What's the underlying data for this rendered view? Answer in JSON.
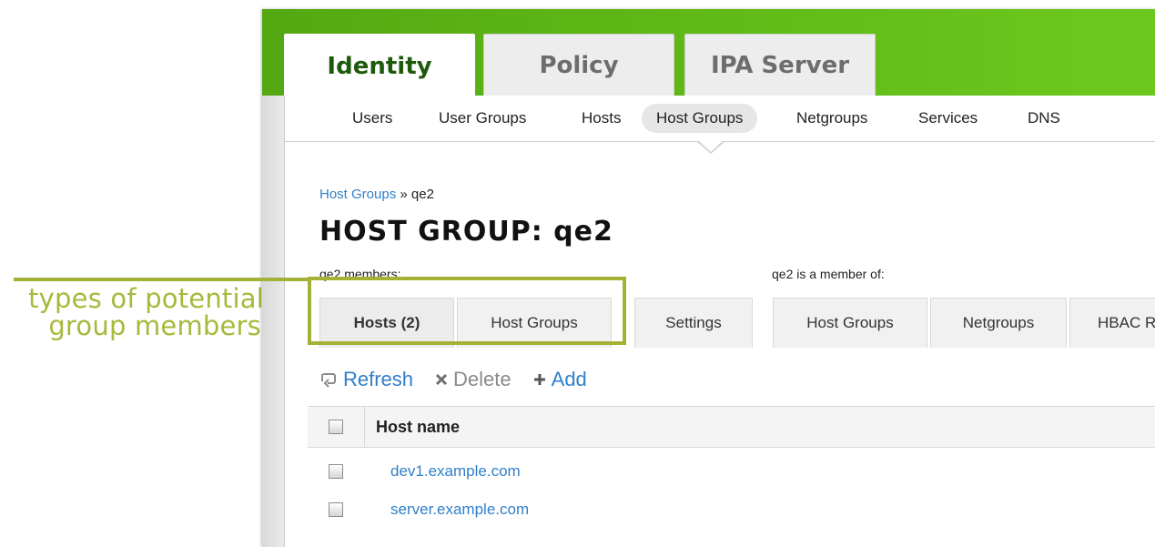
{
  "annotation": {
    "line1": "types of potential",
    "line2": "group members"
  },
  "top_tabs": [
    {
      "label": "Identity",
      "active": true
    },
    {
      "label": "Policy",
      "active": false
    },
    {
      "label": "IPA Server",
      "active": false
    }
  ],
  "subnav": {
    "items": [
      {
        "label": "Users"
      },
      {
        "label": "User Groups"
      },
      {
        "label": "Hosts"
      },
      {
        "label": "Host Groups",
        "active": true
      },
      {
        "label": "Netgroups"
      },
      {
        "label": "Services"
      },
      {
        "label": "DNS"
      }
    ]
  },
  "breadcrumb": {
    "link": "Host Groups",
    "separator": "»",
    "current": "qe2"
  },
  "page_title": {
    "prefix": "HOST GROUP:",
    "name": "qe2"
  },
  "facet_groups": {
    "members_label": "qe2 members:",
    "memberof_label": "qe2 is a member of:"
  },
  "facet_tabs": [
    {
      "label": "Hosts (2)",
      "active": true
    },
    {
      "label": "Host Groups"
    },
    {
      "label": "Settings"
    },
    {
      "label": "Host Groups"
    },
    {
      "label": "Netgroups"
    },
    {
      "label": "HBAC Rules"
    }
  ],
  "actions": {
    "refresh": "Refresh",
    "delete": "Delete",
    "add": "Add"
  },
  "table": {
    "header": "Host name",
    "rows": [
      {
        "host": "dev1.example.com"
      },
      {
        "host": "server.example.com"
      }
    ]
  },
  "colors": {
    "header_green": "#5fb816",
    "link_blue": "#2f7fc9",
    "annotation": "#a3b236"
  }
}
